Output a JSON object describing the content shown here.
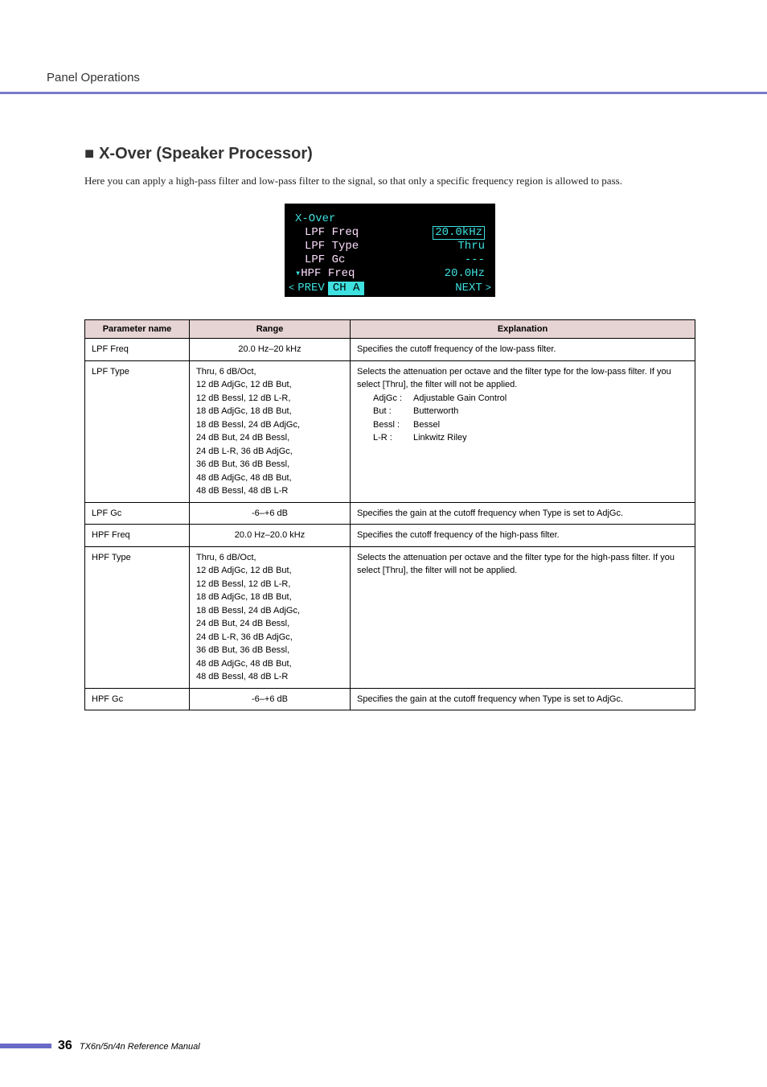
{
  "header": {
    "title": "Panel Operations"
  },
  "section": {
    "title": "X-Over (Speaker Processor)",
    "intro": "Here you can apply a high-pass filter and low-pass filter to the signal, so that only a specific frequency region is allowed to pass."
  },
  "lcd": {
    "title": "X-Over",
    "rows": [
      {
        "label": "LPF Freq",
        "value": "20.0kHz",
        "boxed": true
      },
      {
        "label": "LPF Type",
        "value": "Thru",
        "boxed": false
      },
      {
        "label": "LPF Gc",
        "value": "---",
        "boxed": false
      },
      {
        "label": "HPF Freq",
        "value": "20.0Hz",
        "boxed": false,
        "marker": "▾"
      }
    ],
    "footer": {
      "prev": "PREV",
      "ch": "CH A",
      "next": "NEXT"
    }
  },
  "table": {
    "headers": [
      "Parameter name",
      "Range",
      "Explanation"
    ],
    "rows": [
      {
        "name": "LPF Freq",
        "range": "20.0 Hz–20 kHz",
        "explanation_main": "Specifies the cutoff frequency of the low-pass filter."
      },
      {
        "name": "LPF Type",
        "range": "Thru, 6 dB/Oct, 12 dB AdjGc, 12 dB But, 12 dB Bessl, 12 dB L-R, 18 dB AdjGc, 18 dB But, 18 dB Bessl, 24 dB AdjGc, 24 dB But, 24 dB Bessl, 24 dB L-R, 36 dB AdjGc, 36 dB But, 36 dB Bessl, 48 dB AdjGc, 48 dB But, 48 dB Bessl, 48 dB L-R",
        "explanation_main": "Selects the attenuation per octave and the filter type for the low-pass filter. If you select [Thru], the filter will not be applied.",
        "defs": [
          {
            "k": "AdjGc :",
            "v": "Adjustable Gain Control"
          },
          {
            "k": "But :",
            "v": "Butterworth"
          },
          {
            "k": "Bessl :",
            "v": "Bessel"
          },
          {
            "k": "L-R :",
            "v": "Linkwitz Riley"
          }
        ]
      },
      {
        "name": "LPF Gc",
        "range": "-6–+6 dB",
        "explanation_main": "Specifies the gain at the cutoff frequency when Type is set to AdjGc."
      },
      {
        "name": "HPF Freq",
        "range": "20.0 Hz–20.0 kHz",
        "explanation_main": "Specifies the cutoff frequency of the high-pass filter."
      },
      {
        "name": "HPF Type",
        "range": "Thru, 6 dB/Oct, 12 dB AdjGc, 12 dB But, 12 dB Bessl, 12 dB L-R, 18 dB AdjGc, 18 dB But, 18 dB Bessl, 24 dB AdjGc, 24 dB But, 24 dB Bessl, 24 dB L-R, 36 dB AdjGc, 36 dB But, 36 dB Bessl, 48 dB AdjGc, 48 dB But, 48 dB Bessl, 48 dB L-R",
        "explanation_main": "Selects the attenuation per octave and the filter type for the high-pass filter. If you select [Thru], the filter will not be applied."
      },
      {
        "name": "HPF Gc",
        "range": "-6–+6 dB",
        "explanation_main": "Specifies the gain at the cutoff frequency when Type is set to AdjGc."
      }
    ]
  },
  "footer": {
    "page": "36",
    "docname": "TX6n/5n/4n  Reference Manual"
  }
}
